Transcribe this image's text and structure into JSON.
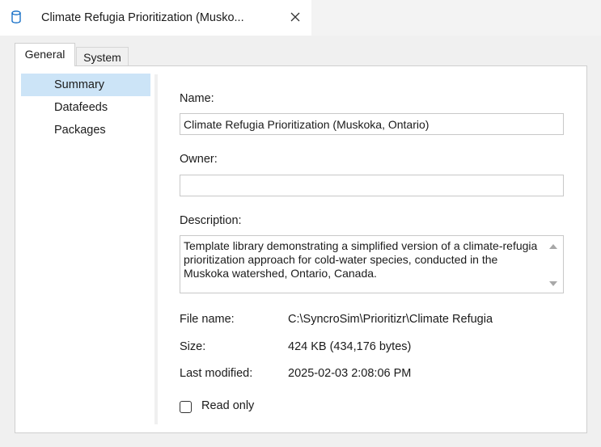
{
  "document_tab": {
    "title": "Climate Refugia Prioritization (Musko...",
    "icon": "database-icon",
    "close_icon": "close-icon"
  },
  "property_tabs": [
    {
      "label": "General",
      "active": true
    },
    {
      "label": "System",
      "active": false
    }
  ],
  "nav": {
    "items": [
      {
        "label": "Summary",
        "selected": true
      },
      {
        "label": "Datafeeds",
        "selected": false
      },
      {
        "label": "Packages",
        "selected": false
      }
    ]
  },
  "fields": {
    "name_label": "Name:",
    "name_value": "Climate Refugia Prioritization (Muskoka, Ontario)",
    "owner_label": "Owner:",
    "owner_value": "",
    "description_label": "Description:",
    "description_value": "Template library demonstrating a simplified version of a climate-refugia prioritization approach for cold-water species, conducted in the Muskoka watershed, Ontario, Canada."
  },
  "info": {
    "file_name_label": "File name:",
    "file_name_value": "C:\\SyncroSim\\Prioritizr\\Climate Refugia",
    "size_label": "Size:",
    "size_value": "424 KB  (434,176 bytes)",
    "last_modified_label": "Last modified:",
    "last_modified_value": "2025-02-03 2:08:06 PM"
  },
  "read_only": {
    "label": "Read only",
    "checked": false
  },
  "colors": {
    "selection": "#cce4f7",
    "background": "#f0f0f0",
    "accent": "#0a68c4"
  }
}
